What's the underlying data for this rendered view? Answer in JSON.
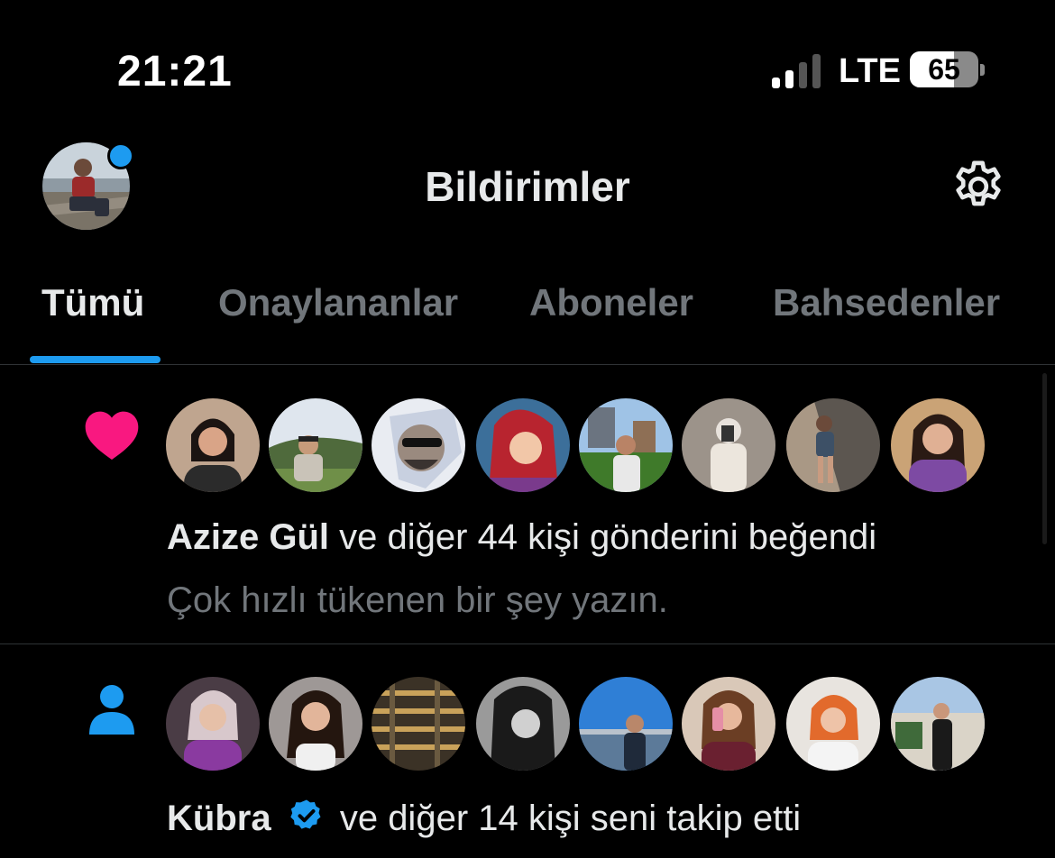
{
  "status_bar": {
    "time": "21:21",
    "network": "LTE",
    "battery_level": "65",
    "battery_fraction": 0.65
  },
  "header": {
    "title": "Bildirimler"
  },
  "tabs": [
    {
      "label": "Tümü",
      "active": true
    },
    {
      "label": "Onaylananlar",
      "active": false
    },
    {
      "label": "Aboneler",
      "active": false
    },
    {
      "label": "Bahsedenler",
      "active": false
    }
  ],
  "notifications": [
    {
      "type": "like",
      "icon": "heart-icon",
      "icon_color": "#f91880",
      "name": "Azize Gül",
      "action_text": " ve diğer 44 kişi gönderini beğendi",
      "post_preview": "Çok hızlı tükenen bir şey yazın."
    },
    {
      "type": "follow",
      "icon": "person-icon",
      "icon_color": "#1d9bf0",
      "name": "Kübra",
      "verified": true,
      "action_text": "ve diğer 14 kişi seni takip etti"
    }
  ],
  "colors": {
    "accent": "#1d9bf0",
    "like": "#f91880",
    "background": "#000000",
    "muted_text": "#71767b"
  }
}
